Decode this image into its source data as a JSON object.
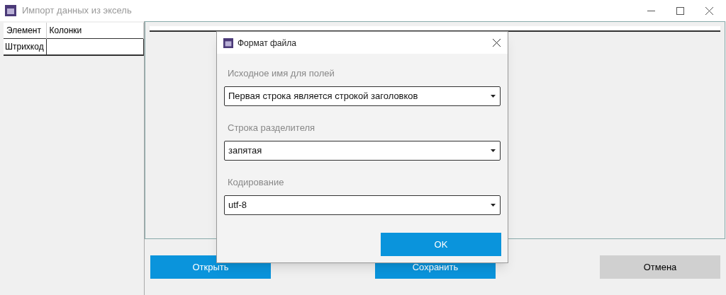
{
  "window": {
    "title": "Импорт данных из эксель"
  },
  "mapping_table": {
    "columns": [
      "Элемент",
      "Колонки"
    ],
    "rows": [
      [
        "Штрихкод",
        ""
      ]
    ]
  },
  "buttons": [
    {
      "label": "Открыть",
      "kind": "primary"
    },
    {
      "label": "Сохранить",
      "kind": "primary"
    },
    {
      "label": "Отмена",
      "kind": "secondary"
    }
  ],
  "dialog": {
    "title": "Формат файла",
    "fields": [
      {
        "label": "Исходное имя для полей",
        "value": "Первая строка является строкой заголовков"
      },
      {
        "label": "Строка разделителя",
        "value": "запятая"
      },
      {
        "label": "Кодирование",
        "value": "utf-8"
      }
    ],
    "ok_button": "OK"
  }
}
